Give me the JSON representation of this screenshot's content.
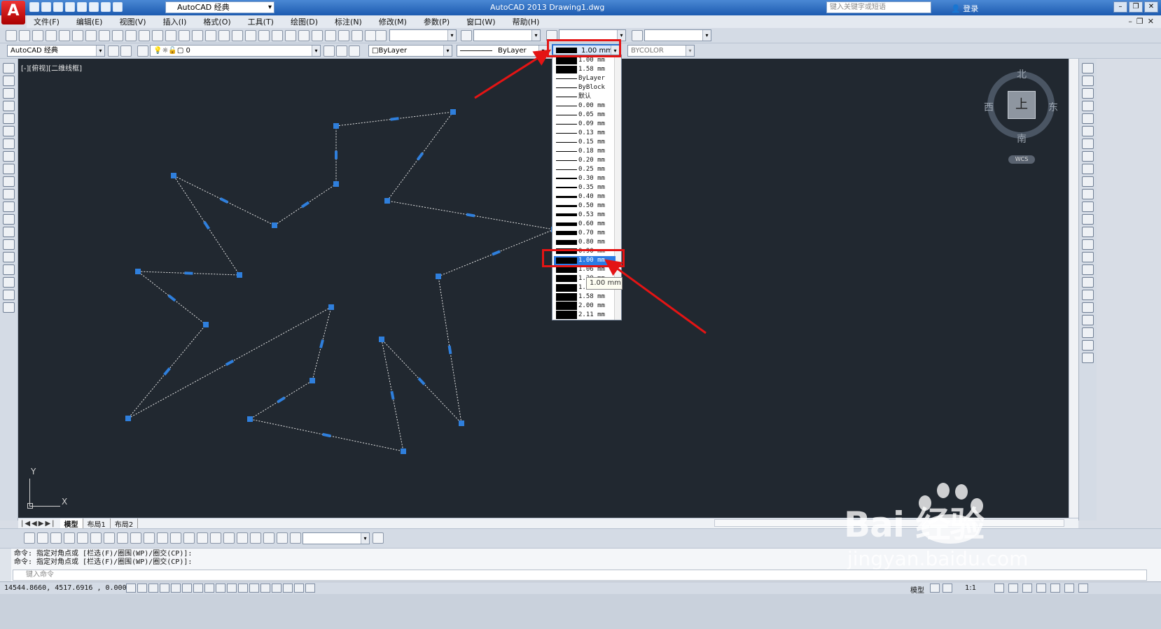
{
  "app": {
    "title": "AutoCAD 2013    Drawing1.dwg",
    "logo_letter": "A",
    "workspace": "AutoCAD 经典",
    "search_placeholder": "键入关键字或短语",
    "login": "登录"
  },
  "menu": [
    "文件(F)",
    "编辑(E)",
    "视图(V)",
    "插入(I)",
    "格式(O)",
    "工具(T)",
    "绘图(D)",
    "标注(N)",
    "修改(M)",
    "参数(P)",
    "窗口(W)",
    "帮助(H)"
  ],
  "toolbar2": {
    "workspace": "AutoCAD 经典",
    "layer": "0",
    "color": "ByLayer",
    "linetype": "ByLayer",
    "lineweight": "1.00 mm",
    "plotstyle": "BYCOLOR"
  },
  "viewport": {
    "label": "[-][俯视][二维线框]",
    "viewcube": {
      "top": "上",
      "north": "北",
      "south": "南",
      "east": "东",
      "west": "西",
      "wcs": "WCS"
    },
    "ucs": {
      "x": "X",
      "y": "Y"
    }
  },
  "lineweight_dropdown": {
    "items": [
      "1.00 mm",
      "1.58 mm",
      "ByLayer",
      "ByBlock",
      "默认",
      "0.00 mm",
      "0.05 mm",
      "0.09 mm",
      "0.13 mm",
      "0.15 mm",
      "0.18 mm",
      "0.20 mm",
      "0.25 mm",
      "0.30 mm",
      "0.35 mm",
      "0.40 mm",
      "0.50 mm",
      "0.53 mm",
      "0.60 mm",
      "0.70 mm",
      "0.80 mm",
      "0.90 mm",
      "1.00 mm",
      "1.06 mm",
      "1.20 mm",
      "1.40 mm",
      "1.58 mm",
      "2.00 mm",
      "2.11 mm"
    ],
    "selected": "1.00 mm",
    "tooltip": "1.00 mm"
  },
  "tabs": [
    "模型",
    "布局1",
    "布局2"
  ],
  "command": {
    "history": [
      "命令: 指定对角点或 [栏选(F)/圈围(WP)/圈交(CP)]:",
      "命令: 指定对角点或 [栏选(F)/圈围(WP)/圈交(CP)]:"
    ],
    "placeholder": "键入命令"
  },
  "status": {
    "coords": "14544.8660, 4517.6916 , 0.0000",
    "mode": "模型",
    "scale": "1:1"
  },
  "watermark": {
    "brand": "Bai  经验",
    "url": "jingyan.baidu.com"
  }
}
